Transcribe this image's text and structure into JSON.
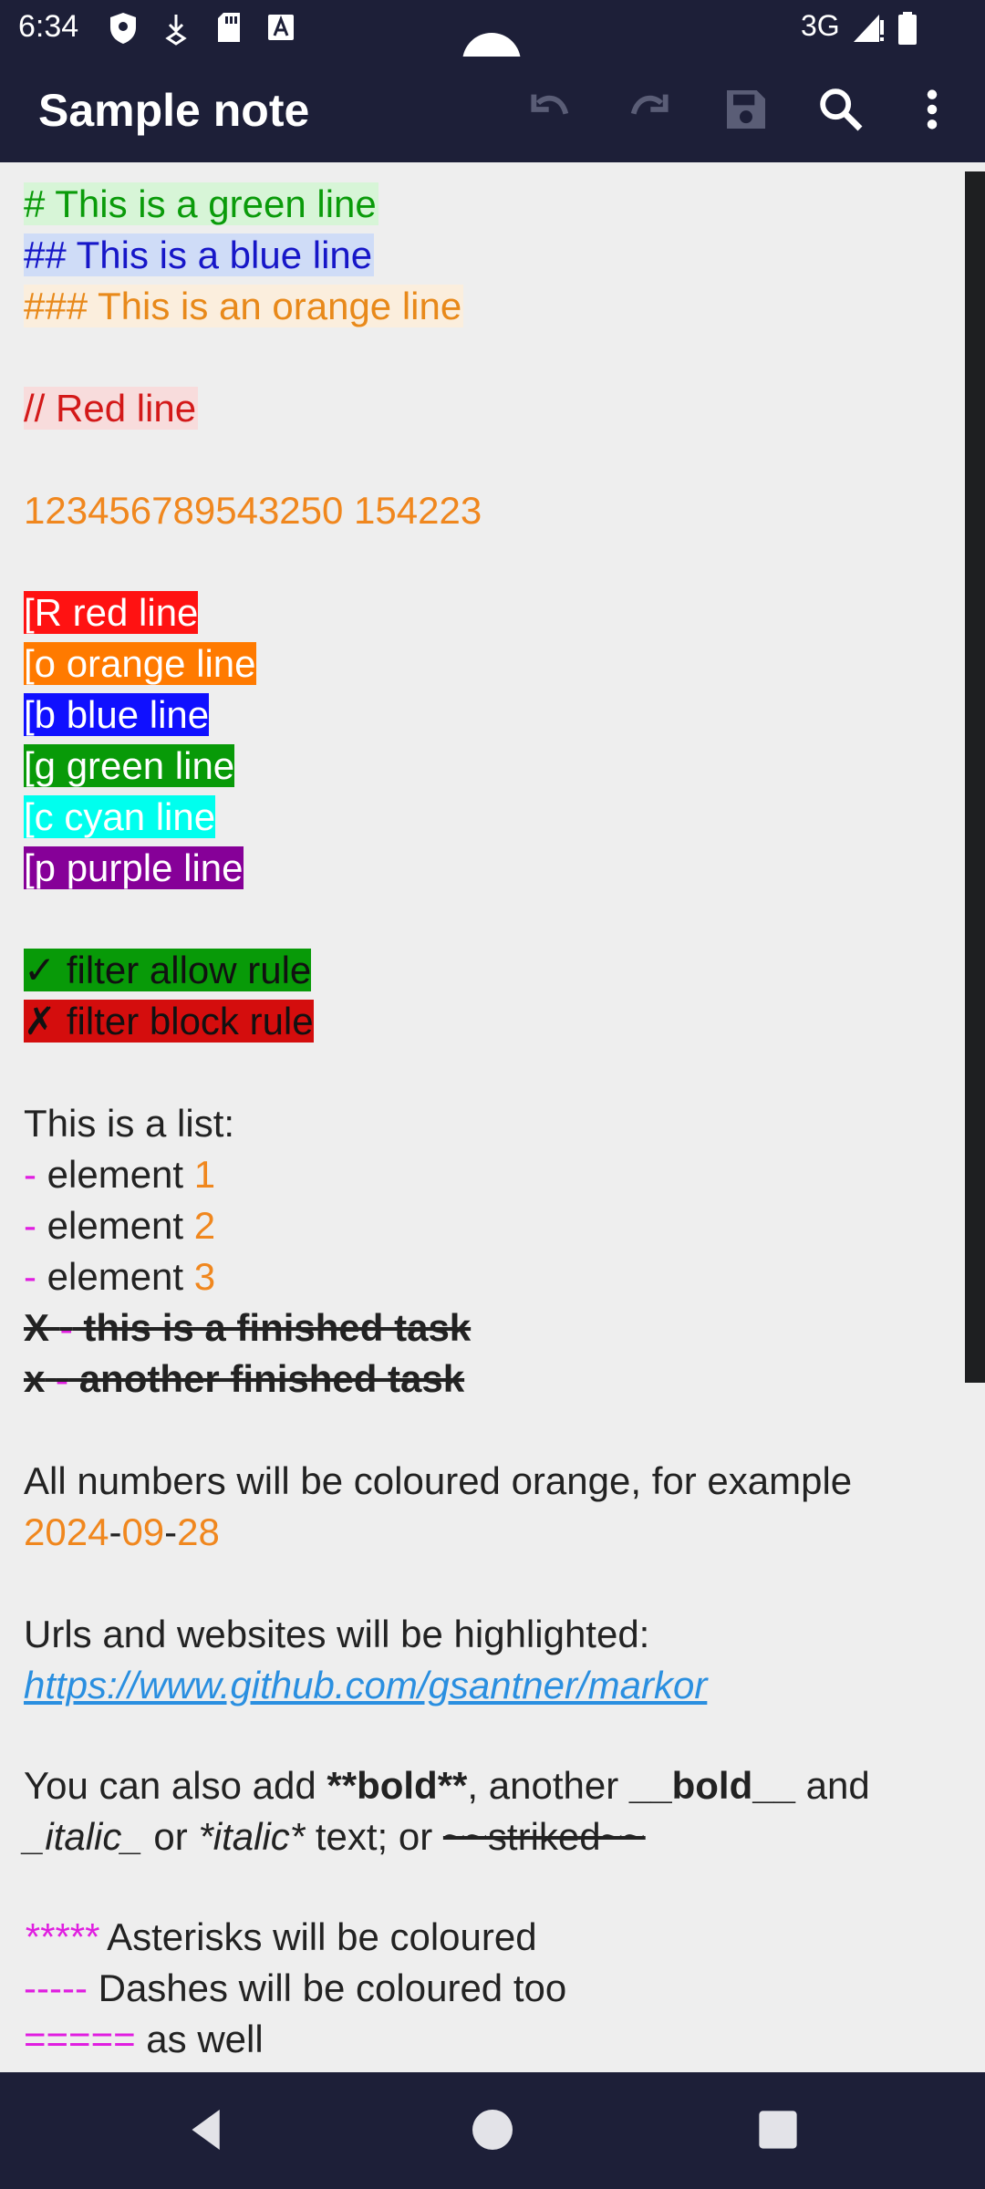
{
  "status_bar": {
    "time": "6:34",
    "network": "3G",
    "icons": [
      "shield-icon",
      "download-icon",
      "sd-card-icon",
      "font-icon",
      "signal-icon",
      "battery-icon"
    ]
  },
  "toolbar": {
    "title": "Sample note",
    "actions": [
      "undo-icon",
      "redo-icon",
      "save-icon",
      "search-icon",
      "more-vert-icon"
    ]
  },
  "editor": {
    "h1": "# This is a green line",
    "h2": "## This is a blue line",
    "h3": "### This is an orange line",
    "comment": "// Red line",
    "numbers": "123456789543250 154223",
    "colored_lines": {
      "red": "[R red line",
      "orange": "[o orange line",
      "blue": "[b blue line",
      "green": "[g green line",
      "cyan": "[c cyan line",
      "purple": "[p purple line"
    },
    "filter_allow": "✓ filter allow rule",
    "filter_block": "✗ filter block rule",
    "list_header": "This is a list:",
    "list_dash": "-",
    "list_item_text": " element ",
    "list_nums": [
      "1",
      "2",
      "3"
    ],
    "task1_mark": "X",
    "task1_text": " this is a finished task",
    "task2_mark": "x",
    "task2_text": " another finished task",
    "numbers_note": "All numbers will be coloured orange, for example",
    "date_parts": [
      "2024",
      "-",
      "09",
      "-",
      "28"
    ],
    "urls_note": "Urls and websites will be highlighted:",
    "url": "https://www.github.com/gsantner/markor",
    "fmt1_a": "You can also add ",
    "fmt1_b": "**bold**",
    "fmt1_c": ", another ",
    "fmt1_d": "__bold__",
    "fmt1_e": " and",
    "fmt2_a": "_italic_",
    "fmt2_b": " or ",
    "fmt2_c": "*italic*",
    "fmt2_d": " text; or ",
    "fmt2_e": "~~striked~~",
    "asterisks": "*****",
    "asterisks_text": " Asterisks will be coloured",
    "dashes": "-----",
    "dashes_text": " Dashes will be coloured too",
    "equals": "=====",
    "equals_text": " as well"
  },
  "nav_bar": {
    "buttons": [
      "back-icon",
      "home-icon",
      "recents-icon"
    ]
  }
}
